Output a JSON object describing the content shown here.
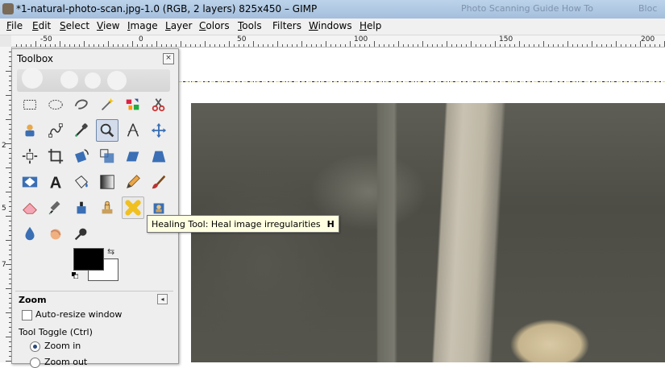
{
  "window": {
    "title": "*1-natural-photo-scan.jpg-1.0 (RGB, 2 layers) 825x450 – GIMP",
    "background_tabs": [
      "Photo Scanning Guide How To",
      "Bloc"
    ]
  },
  "menubar": {
    "items": [
      {
        "underline": "F",
        "rest": "ile"
      },
      {
        "underline": "E",
        "rest": "dit"
      },
      {
        "underline": "S",
        "rest": "elect"
      },
      {
        "underline": "V",
        "rest": "iew"
      },
      {
        "underline": "I",
        "rest": "mage"
      },
      {
        "underline": "L",
        "rest": "ayer"
      },
      {
        "underline": "C",
        "rest": "olors"
      },
      {
        "underline": "T",
        "rest": "ools"
      },
      {
        "underline": "",
        "rest": "Filters"
      },
      {
        "underline": "W",
        "rest": "indows"
      },
      {
        "underline": "H",
        "rest": "elp"
      }
    ]
  },
  "ruler": {
    "top_labels": [
      "-50",
      "0",
      "50",
      "100",
      "150",
      "200"
    ],
    "left_labels": [
      "2",
      "5",
      "7"
    ]
  },
  "toolbox": {
    "title": "Toolbox",
    "close_icon": "close-icon",
    "tools": [
      "rect-select-icon",
      "ellipse-select-icon",
      "free-select-icon",
      "fuzzy-select-icon",
      "select-by-color-icon",
      "scissors-select-icon",
      "foreground-select-icon",
      "paths-icon",
      "color-picker-icon",
      "zoom-icon",
      "measure-icon",
      "move-icon",
      "align-icon",
      "crop-icon",
      "rotate-icon",
      "scale-icon",
      "shear-icon",
      "perspective-icon",
      "flip-icon",
      "text-icon",
      "bucket-fill-icon",
      "blend-icon",
      "pencil-icon",
      "paintbrush-icon",
      "eraser-icon",
      "airbrush-icon",
      "ink-icon",
      "clone-icon",
      "heal-icon",
      "perspective-clone-icon",
      "blur-icon",
      "smudge-icon",
      "dodge-burn-icon"
    ],
    "active_tool": "zoom-icon",
    "hover_tool": "heal-icon",
    "colors": {
      "foreground": "#000000",
      "background": "#ffffff"
    },
    "options": {
      "title": "Zoom",
      "auto_resize_label": "Auto-resize window",
      "auto_resize_checked": false,
      "tool_toggle_label": "Tool Toggle  (Ctrl)",
      "zoom_in_label": "Zoom in",
      "zoom_out_label": "Zoom out",
      "selected": "Zoom in"
    }
  },
  "tooltip": {
    "text": "Healing Tool: Heal image irregularities",
    "shortcut": "H"
  }
}
